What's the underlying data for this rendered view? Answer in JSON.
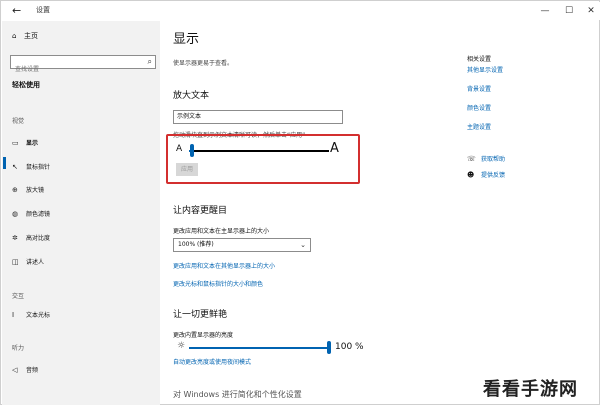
{
  "window": {
    "title": "设置",
    "back_icon": "←",
    "min_icon": "—",
    "max_icon": "☐",
    "close_icon": "✕"
  },
  "sidebar": {
    "home": "主页",
    "search_placeholder": "查找设置",
    "category": "轻松使用",
    "sections": {
      "vision": "视觉",
      "interaction": "交互",
      "hearing": "听力"
    },
    "items": [
      {
        "label": "显示",
        "icon": "▭"
      },
      {
        "label": "鼠标指针",
        "icon": "↖"
      },
      {
        "label": "放大镜",
        "icon": "⊕"
      },
      {
        "label": "颜色滤镜",
        "icon": "◍"
      },
      {
        "label": "高对比度",
        "icon": "✲"
      },
      {
        "label": "讲述人",
        "icon": "◫"
      },
      {
        "label": "文本光标",
        "icon": "I"
      },
      {
        "label": "音频",
        "icon": "◁"
      }
    ]
  },
  "main": {
    "title": "显示",
    "subtitle": "使显示器更易于查看。",
    "zoom_heading": "放大文本",
    "sample_text": "示例文本",
    "hint": "拖动滑块直到示例文本清晰可读，然后单击“应用”",
    "slider_small": "A",
    "slider_big": "A",
    "slider_level": 0.02,
    "apply": "应用",
    "bigger_heading": "让内容更醒目",
    "scale_label": "更改应用和文本在主显示器上的大小",
    "scale_value": "100% (推荐)",
    "link1": "更改应用和文本在其他显示器上的大小",
    "link2": "更改光标和鼠标指针的大小和颜色",
    "bright_heading": "让一切更鲜艳",
    "bright_label": "更改内置显示器的亮度",
    "bright_link": "自动更改亮度或使用夜间模式",
    "brightness": 100,
    "brightness_text": "100 %",
    "bottom_heading": "对 Windows 进行简化和个性化设置"
  },
  "right": {
    "heading": "相关设置",
    "links": [
      "其他显示设置",
      "背景设置",
      "颜色设置",
      "主题设置"
    ],
    "help": [
      {
        "label": "获取帮助",
        "icon": "☏"
      },
      {
        "label": "提供反馈",
        "icon": "☻"
      }
    ]
  },
  "watermark": "看看手游网"
}
